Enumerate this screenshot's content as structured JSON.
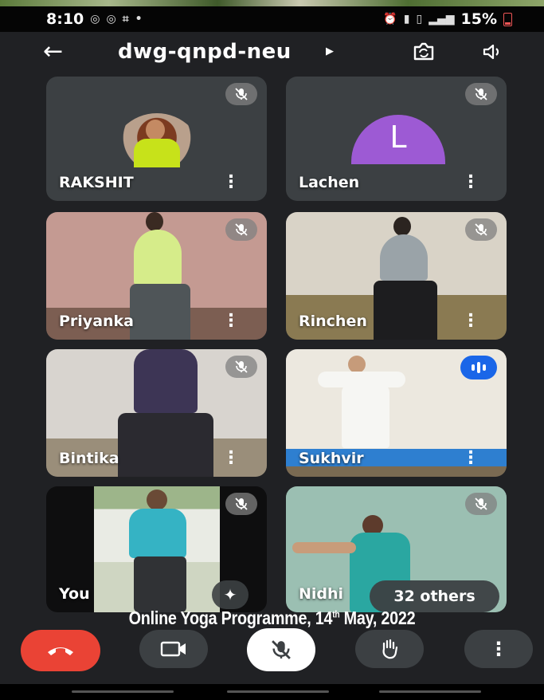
{
  "status_bar": {
    "time": "8:10",
    "battery": "15%",
    "icons": [
      "whatsapp-icon",
      "whatsapp-icon",
      "screenshot-icon",
      "alarm-icon",
      "signal-icon",
      "volte-icon",
      "battery-icon"
    ]
  },
  "topbar": {
    "meeting_code": "dwg-qnpd-neu",
    "icons": [
      "back-arrow-icon",
      "caret-right-icon",
      "switch-camera-icon",
      "speaker-icon"
    ]
  },
  "tiles": [
    {
      "name": "RAKSHIT",
      "muted": true
    },
    {
      "name": "Lachen",
      "avatar_letter": "L",
      "avatar_color": "#9d5ad4",
      "muted": true
    },
    {
      "name": "Priyanka",
      "muted": true
    },
    {
      "name": "Rinchen",
      "muted": true
    },
    {
      "name": "Bintika",
      "muted": true
    },
    {
      "name": "Sukhvir",
      "speaking": true
    },
    {
      "name": "You",
      "muted": true
    },
    {
      "name": "Nidhi",
      "muted": true
    }
  ],
  "more_symbol": "⋮",
  "others_label": "32 others",
  "caption": {
    "pre": "Online Yoga Programme, 14",
    "sup": "th",
    "post": " May, 2022"
  },
  "controls": {
    "icons": [
      "end-call-icon",
      "camera-icon",
      "mic-off-icon",
      "raise-hand-icon",
      "more-vert-icon"
    ],
    "more_symbol": "⋮"
  },
  "colors": {
    "end_call": "#ea4335",
    "speaking_badge": "#1a66e8",
    "background": "#202124"
  }
}
